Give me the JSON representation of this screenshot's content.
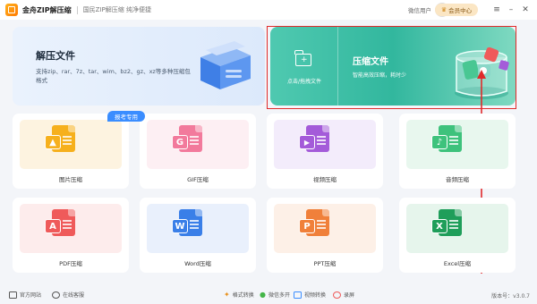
{
  "titlebar": {
    "app_name": "金舟ZIP解压缩",
    "slogan": "国民ZIP解压缩  纯净便捷",
    "user_name": "微信用户",
    "vip_label": "会员中心",
    "minimize_glyph": "–",
    "close_glyph": "✕"
  },
  "extract": {
    "title": "解压文件",
    "description": "支持zip、rar、7z、tar、wim、bz2、gz、xz等多种压缩包格式"
  },
  "compress": {
    "add_label": "点击/拖拽文件",
    "title": "压缩文件",
    "description": "智能高效压缩，耗时少"
  },
  "badge": {
    "exam": "报考专用"
  },
  "cards": [
    {
      "label": "图片压缩",
      "badge_glyph": "▲",
      "color": "#f6b01d",
      "bg": "#fdf3e0"
    },
    {
      "label": "GIF压缩",
      "badge_glyph": "G",
      "color": "#f27a9c",
      "bg": "#fdeff3"
    },
    {
      "label": "视频压缩",
      "badge_glyph": "▶",
      "color": "#a45bd9",
      "bg": "#f3ecfb"
    },
    {
      "label": "音频压缩",
      "badge_glyph": "♪",
      "color": "#3ec27c",
      "bg": "#e8f7ee"
    },
    {
      "label": "PDF压缩",
      "badge_glyph": "A",
      "color": "#ef5a5a",
      "bg": "#fdecec"
    },
    {
      "label": "Word压缩",
      "badge_glyph": "W",
      "color": "#3a7fe8",
      "bg": "#e9f0fc"
    },
    {
      "label": "PPT压缩",
      "badge_glyph": "P",
      "color": "#f0803a",
      "bg": "#fdf0e7"
    },
    {
      "label": "Excel压缩",
      "badge_glyph": "X",
      "color": "#1f9e5a",
      "bg": "#e6f5ec"
    }
  ],
  "footer": {
    "website": "官方网站",
    "support": "在线客服",
    "format_convert": "格式转换",
    "wechat_multi": "微信多开",
    "video_convert": "视频转换",
    "screen_record": "录屏",
    "version": "版本号：v3.0.7"
  },
  "colors": {
    "accent_teal": "#32b79e",
    "highlight_red": "#e02a2a",
    "badge_blue": "#3a8dff"
  }
}
